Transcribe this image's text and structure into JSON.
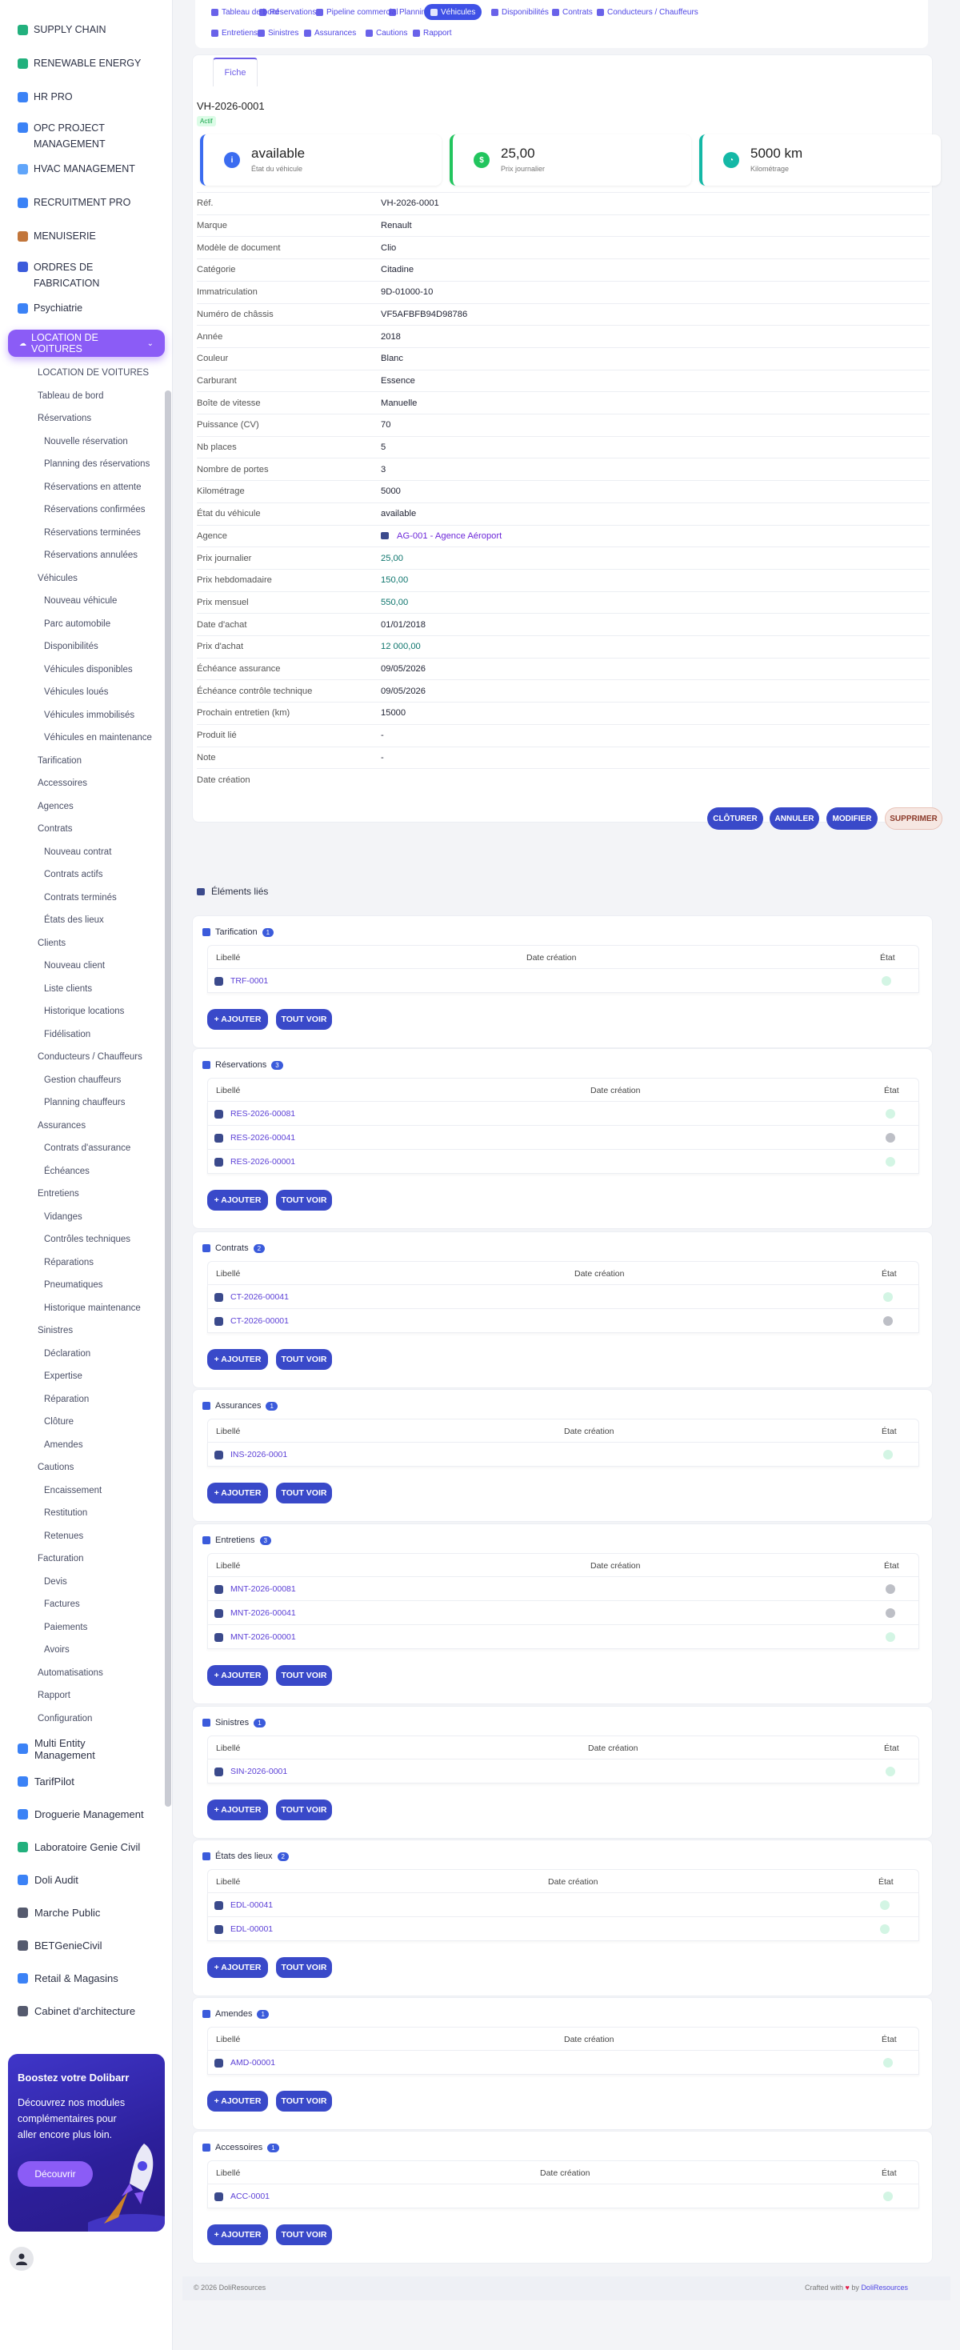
{
  "sidebar": {
    "modules_top": [
      {
        "label": "SUPPLY CHAIN",
        "color": "#22b07d"
      },
      {
        "label": "RENEWABLE ENERGY",
        "color": "#22b07d"
      },
      {
        "label": "HR PRO",
        "color": "#3b82f6"
      },
      {
        "label": "OPC PROJECT MANAGEMENT",
        "color": "#3b82f6"
      },
      {
        "label": "HVAC MANAGEMENT",
        "color": "#60a5fa"
      },
      {
        "label": "RECRUITMENT PRO",
        "color": "#3b82f6"
      },
      {
        "label": "MENUISERIE",
        "color": "#c2763b"
      },
      {
        "label": "ORDRES DE FABRICATION",
        "color": "#3b5bdb"
      },
      {
        "label": "Psychiatrie",
        "color": "#3b82f6"
      }
    ],
    "active_module": "LOCATION DE VOITURES",
    "menu": [
      {
        "label": "LOCATION DE VOITURES",
        "lvl": "l0"
      },
      {
        "label": "Tableau de bord",
        "lvl": "l1"
      },
      {
        "label": "Réservations",
        "lvl": "l1"
      },
      {
        "label": "Nouvelle réservation",
        "lvl": "l2"
      },
      {
        "label": "Planning des réservations",
        "lvl": "l2"
      },
      {
        "label": "Réservations en attente",
        "lvl": "l2"
      },
      {
        "label": "Réservations confirmées",
        "lvl": "l2"
      },
      {
        "label": "Réservations terminées",
        "lvl": "l2"
      },
      {
        "label": "Réservations annulées",
        "lvl": "l2"
      },
      {
        "label": "Véhicules",
        "lvl": "l1"
      },
      {
        "label": "Nouveau véhicule",
        "lvl": "l2"
      },
      {
        "label": "Parc automobile",
        "lvl": "l2"
      },
      {
        "label": "Disponibilités",
        "lvl": "l2"
      },
      {
        "label": "Véhicules disponibles",
        "lvl": "l2"
      },
      {
        "label": "Véhicules loués",
        "lvl": "l2"
      },
      {
        "label": "Véhicules immobilisés",
        "lvl": "l2"
      },
      {
        "label": "Véhicules en maintenance",
        "lvl": "l2"
      },
      {
        "label": "Tarification",
        "lvl": "l1"
      },
      {
        "label": "Accessoires",
        "lvl": "l1"
      },
      {
        "label": "Agences",
        "lvl": "l1"
      },
      {
        "label": "Contrats",
        "lvl": "l1"
      },
      {
        "label": "Nouveau contrat",
        "lvl": "l2"
      },
      {
        "label": "Contrats actifs",
        "lvl": "l2"
      },
      {
        "label": "Contrats terminés",
        "lvl": "l2"
      },
      {
        "label": "États des lieux",
        "lvl": "l2"
      },
      {
        "label": "Clients",
        "lvl": "l1"
      },
      {
        "label": "Nouveau client",
        "lvl": "l2"
      },
      {
        "label": "Liste clients",
        "lvl": "l2"
      },
      {
        "label": "Historique locations",
        "lvl": "l2"
      },
      {
        "label": "Fidélisation",
        "lvl": "l2"
      },
      {
        "label": "Conducteurs / Chauffeurs",
        "lvl": "l1"
      },
      {
        "label": "Gestion chauffeurs",
        "lvl": "l2"
      },
      {
        "label": "Planning chauffeurs",
        "lvl": "l2"
      },
      {
        "label": "Assurances",
        "lvl": "l1"
      },
      {
        "label": "Contrats d'assurance",
        "lvl": "l2"
      },
      {
        "label": "Échéances",
        "lvl": "l2"
      },
      {
        "label": "Entretiens",
        "lvl": "l1"
      },
      {
        "label": "Vidanges",
        "lvl": "l2"
      },
      {
        "label": "Contrôles techniques",
        "lvl": "l2"
      },
      {
        "label": "Réparations",
        "lvl": "l2"
      },
      {
        "label": "Pneumatiques",
        "lvl": "l2"
      },
      {
        "label": "Historique maintenance",
        "lvl": "l2"
      },
      {
        "label": "Sinistres",
        "lvl": "l1"
      },
      {
        "label": "Déclaration",
        "lvl": "l2"
      },
      {
        "label": "Expertise",
        "lvl": "l2"
      },
      {
        "label": "Réparation",
        "lvl": "l2"
      },
      {
        "label": "Clôture",
        "lvl": "l2"
      },
      {
        "label": "Amendes",
        "lvl": "l2"
      },
      {
        "label": "Cautions",
        "lvl": "l1"
      },
      {
        "label": "Encaissement",
        "lvl": "l2"
      },
      {
        "label": "Restitution",
        "lvl": "l2"
      },
      {
        "label": "Retenues",
        "lvl": "l2"
      },
      {
        "label": "Facturation",
        "lvl": "l1"
      },
      {
        "label": "Devis",
        "lvl": "l2"
      },
      {
        "label": "Factures",
        "lvl": "l2"
      },
      {
        "label": "Paiements",
        "lvl": "l2"
      },
      {
        "label": "Avoirs",
        "lvl": "l2"
      },
      {
        "label": "Automatisations",
        "lvl": "l1"
      },
      {
        "label": "Rapport",
        "lvl": "l1"
      },
      {
        "label": "Configuration",
        "lvl": "l1"
      }
    ],
    "modules_bottom": [
      {
        "label": "Multi Entity Management",
        "color": "#3b82f6"
      },
      {
        "label": "TarifPilot",
        "color": "#3b82f6"
      },
      {
        "label": "Droguerie Management",
        "color": "#3b82f6"
      },
      {
        "label": "Laboratoire Genie Civil",
        "color": "#22b07d"
      },
      {
        "label": "Doli Audit",
        "color": "#3b82f6"
      },
      {
        "label": "Marche Public",
        "color": "#555a6e"
      },
      {
        "label": "BETGenieCivil",
        "color": "#555a6e"
      },
      {
        "label": "Retail & Magasins",
        "color": "#3b82f6"
      },
      {
        "label": "Cabinet d'architecture",
        "color": "#555a6e"
      }
    ],
    "promo": {
      "title": "Boostez votre Dolibarr",
      "text": "Découvrez nos modules complémentaires pour aller encore plus loin.",
      "button": "Découvrir"
    }
  },
  "tabs": [
    {
      "label": "Tableau de bord",
      "active": false
    },
    {
      "label": "Réservations",
      "active": false
    },
    {
      "label": "Pipeline commercial",
      "active": false
    },
    {
      "label": "Planning",
      "active": false
    },
    {
      "label": "Véhicules",
      "active": true
    },
    {
      "label": "Disponibilités",
      "active": false
    },
    {
      "label": "Contrats",
      "active": false
    },
    {
      "label": "Conducteurs / Chauffeurs",
      "active": false
    },
    {
      "label": "Entretiens",
      "active": false
    },
    {
      "label": "Sinistres",
      "active": false
    },
    {
      "label": "Assurances",
      "active": false
    },
    {
      "label": "Cautions",
      "active": false
    },
    {
      "label": "Rapport",
      "active": false
    }
  ],
  "fiche_tab": "Fiche",
  "record": {
    "ref": "VH-2026-0001",
    "status": "Actif"
  },
  "kpis": [
    {
      "value": "available",
      "label": "État du véhicule",
      "color": "#3b6cf0",
      "icon": "info-icon"
    },
    {
      "value": "25,00",
      "label": "Prix journalier",
      "color": "#22c55e",
      "icon": "money-icon"
    },
    {
      "value": "5000 km",
      "label": "Kilométrage",
      "color": "#14b8a6",
      "icon": "gauge-icon"
    }
  ],
  "fields": [
    {
      "k": "Réf.",
      "v": "VH-2026-0001",
      "s": "bold"
    },
    {
      "k": "Marque",
      "v": "Renault",
      "s": "bold"
    },
    {
      "k": "Modèle de document",
      "v": "Clio",
      "s": "bold"
    },
    {
      "k": "Catégorie",
      "v": "Citadine",
      "s": "bold"
    },
    {
      "k": "Immatriculation",
      "v": "9D-01000-10",
      "s": "bold"
    },
    {
      "k": "Numéro de châssis",
      "v": "VF5AFBFB94D98786",
      "s": "bold"
    },
    {
      "k": "Année",
      "v": "2018",
      "s": "bold"
    },
    {
      "k": "Couleur",
      "v": "Blanc",
      "s": "bold"
    },
    {
      "k": "Carburant",
      "v": "Essence",
      "s": "bold"
    },
    {
      "k": "Boîte de vitesse",
      "v": "Manuelle",
      "s": "bold"
    },
    {
      "k": "Puissance (CV)",
      "v": "70",
      "s": "bold"
    },
    {
      "k": "Nb places",
      "v": "5",
      "s": "bold"
    },
    {
      "k": "Nombre de portes",
      "v": "3",
      "s": "bold"
    },
    {
      "k": "Kilométrage",
      "v": "5000",
      "s": "bold"
    },
    {
      "k": "État du véhicule",
      "v": "available",
      "s": "bold"
    },
    {
      "k": "Agence",
      "v": "AG-001 - Agence Aéroport",
      "s": "link"
    },
    {
      "k": "Prix journalier",
      "v": "25,00",
      "s": "teal"
    },
    {
      "k": "Prix hebdomadaire",
      "v": "150,00",
      "s": "teal"
    },
    {
      "k": "Prix mensuel",
      "v": "550,00",
      "s": "teal"
    },
    {
      "k": "Date d'achat",
      "v": "01/01/2018",
      "s": "bold"
    },
    {
      "k": "Prix d'achat",
      "v": "12 000,00",
      "s": "teal"
    },
    {
      "k": "Échéance assurance",
      "v": "09/05/2026",
      "s": "bold"
    },
    {
      "k": "Échéance contrôle technique",
      "v": "09/05/2026",
      "s": "bold"
    },
    {
      "k": "Prochain entretien (km)",
      "v": "15000",
      "s": "bold"
    },
    {
      "k": "Produit lié",
      "v": "-",
      "s": "plain"
    },
    {
      "k": "Note",
      "v": "-",
      "s": "plain"
    },
    {
      "k": "Date création",
      "v": "",
      "s": "plain"
    }
  ],
  "actions": {
    "close": "CLÔTURER",
    "cancel": "ANNULER",
    "edit": "MODIFIER",
    "delete": "SUPPRIMER"
  },
  "linked": {
    "title": "Éléments liés",
    "col_label": "Libellé",
    "col_date": "Date création",
    "col_state": "État",
    "add": "+ AJOUTER",
    "all": "TOUT VOIR",
    "sections": [
      {
        "title": "Tarification",
        "count": "1",
        "rows": [
          {
            "ref": "TRF-0001",
            "state": "green"
          }
        ]
      },
      {
        "title": "Réservations",
        "count": "3",
        "rows": [
          {
            "ref": "RES-2026-00081",
            "state": "green"
          },
          {
            "ref": "RES-2026-00041",
            "state": "gray"
          },
          {
            "ref": "RES-2026-00001",
            "state": "green"
          }
        ]
      },
      {
        "title": "Contrats",
        "count": "2",
        "rows": [
          {
            "ref": "CT-2026-00041",
            "state": "green"
          },
          {
            "ref": "CT-2026-00001",
            "state": "gray"
          }
        ]
      },
      {
        "title": "Assurances",
        "count": "1",
        "rows": [
          {
            "ref": "INS-2026-0001",
            "state": "green"
          }
        ]
      },
      {
        "title": "Entretiens",
        "count": "3",
        "rows": [
          {
            "ref": "MNT-2026-00081",
            "state": "gray"
          },
          {
            "ref": "MNT-2026-00041",
            "state": "gray"
          },
          {
            "ref": "MNT-2026-00001",
            "state": "green"
          }
        ]
      },
      {
        "title": "Sinistres",
        "count": "1",
        "rows": [
          {
            "ref": "SIN-2026-0001",
            "state": "green"
          }
        ]
      },
      {
        "title": "États des lieux",
        "count": "2",
        "rows": [
          {
            "ref": "EDL-00041",
            "state": "green"
          },
          {
            "ref": "EDL-00001",
            "state": "green"
          }
        ]
      },
      {
        "title": "Amendes",
        "count": "1",
        "rows": [
          {
            "ref": "AMD-00001",
            "state": "green"
          }
        ]
      },
      {
        "title": "Accessoires",
        "count": "1",
        "rows": [
          {
            "ref": "ACC-0001",
            "state": "green"
          }
        ]
      }
    ]
  },
  "footer": {
    "copyright": "© 2026 DoliResources",
    "crafted": "Crafted with",
    "by": "by",
    "brand": "DoliResources"
  }
}
